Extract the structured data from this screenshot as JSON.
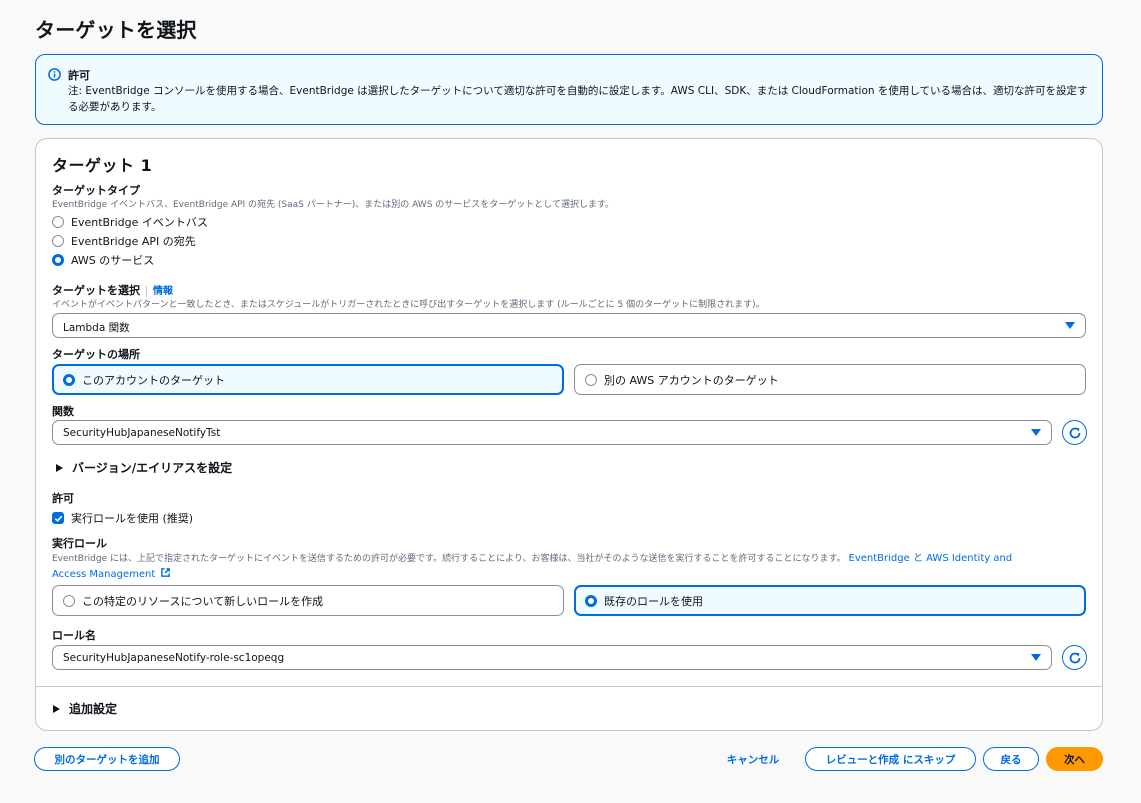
{
  "page": {
    "title": "ターゲットを選択"
  },
  "alert": {
    "title": "許可",
    "body": "注: EventBridge コンソールを使用する場合、EventBridge は選択したターゲットについて適切な許可を自動的に設定します。AWS CLI、SDK、または CloudFormation を使用している場合は、適切な許可を設定する必要があります。",
    "icon": "info-icon"
  },
  "target": {
    "heading": "ターゲット 1",
    "type": {
      "label": "ターゲットタイプ",
      "description": "EventBridge イベントバス、EventBridge API の宛先 (SaaS パートナー)、または別の AWS のサービスをターゲットとして選択します。",
      "options": [
        {
          "label": "EventBridge イベントバス",
          "selected": false
        },
        {
          "label": "EventBridge API の宛先",
          "selected": false
        },
        {
          "label": "AWS のサービス",
          "selected": true
        }
      ]
    },
    "select_target": {
      "label": "ターゲットを選択",
      "info": "情報",
      "description": "イベントがイベントパターンと一致したとき、またはスケジュールがトリガーされたときに呼び出すターゲットを選択します (ルールごとに 5 個のターゲットに制限されます)。",
      "value": "Lambda 関数"
    },
    "location": {
      "label": "ターゲットの場所",
      "options": [
        {
          "label": "このアカウントのターゲット",
          "selected": true
        },
        {
          "label": "別の AWS アカウントのターゲット",
          "selected": false
        }
      ]
    },
    "function": {
      "label": "関数",
      "value": "SecurityHubJapaneseNotifyTst"
    },
    "version_alias": {
      "label": "バージョン/エイリアスを設定"
    },
    "permission": {
      "label": "許可",
      "checkbox_label": "実行ロールを使用 (推奨)",
      "checked": true
    },
    "execution_role": {
      "label": "実行ロール",
      "description": "EventBridge には、上記で指定されたターゲットにイベントを送信するための許可が必要です。続行することにより、お客様は、当社がそのような送信を実行することを許可することになります。",
      "link_line1": "EventBridge と AWS Identity and",
      "link_line2": "Access Management",
      "options": [
        {
          "label": "この特定のリソースについて新しいロールを作成",
          "selected": false
        },
        {
          "label": "既存のロールを使用",
          "selected": true
        }
      ]
    },
    "role_name": {
      "label": "ロール名",
      "value": "SecurityHubJapaneseNotify-role-sc1opeqg"
    },
    "additional": {
      "label": "追加設定"
    }
  },
  "footer": {
    "add_target": "別のターゲットを追加",
    "cancel": "キャンセル",
    "skip_review": "レビューと作成 にスキップ",
    "back": "戻る",
    "next": "次へ"
  },
  "colors": {
    "accent": "#006ce0",
    "primary": "#ff9900",
    "text": "#0f141a"
  }
}
